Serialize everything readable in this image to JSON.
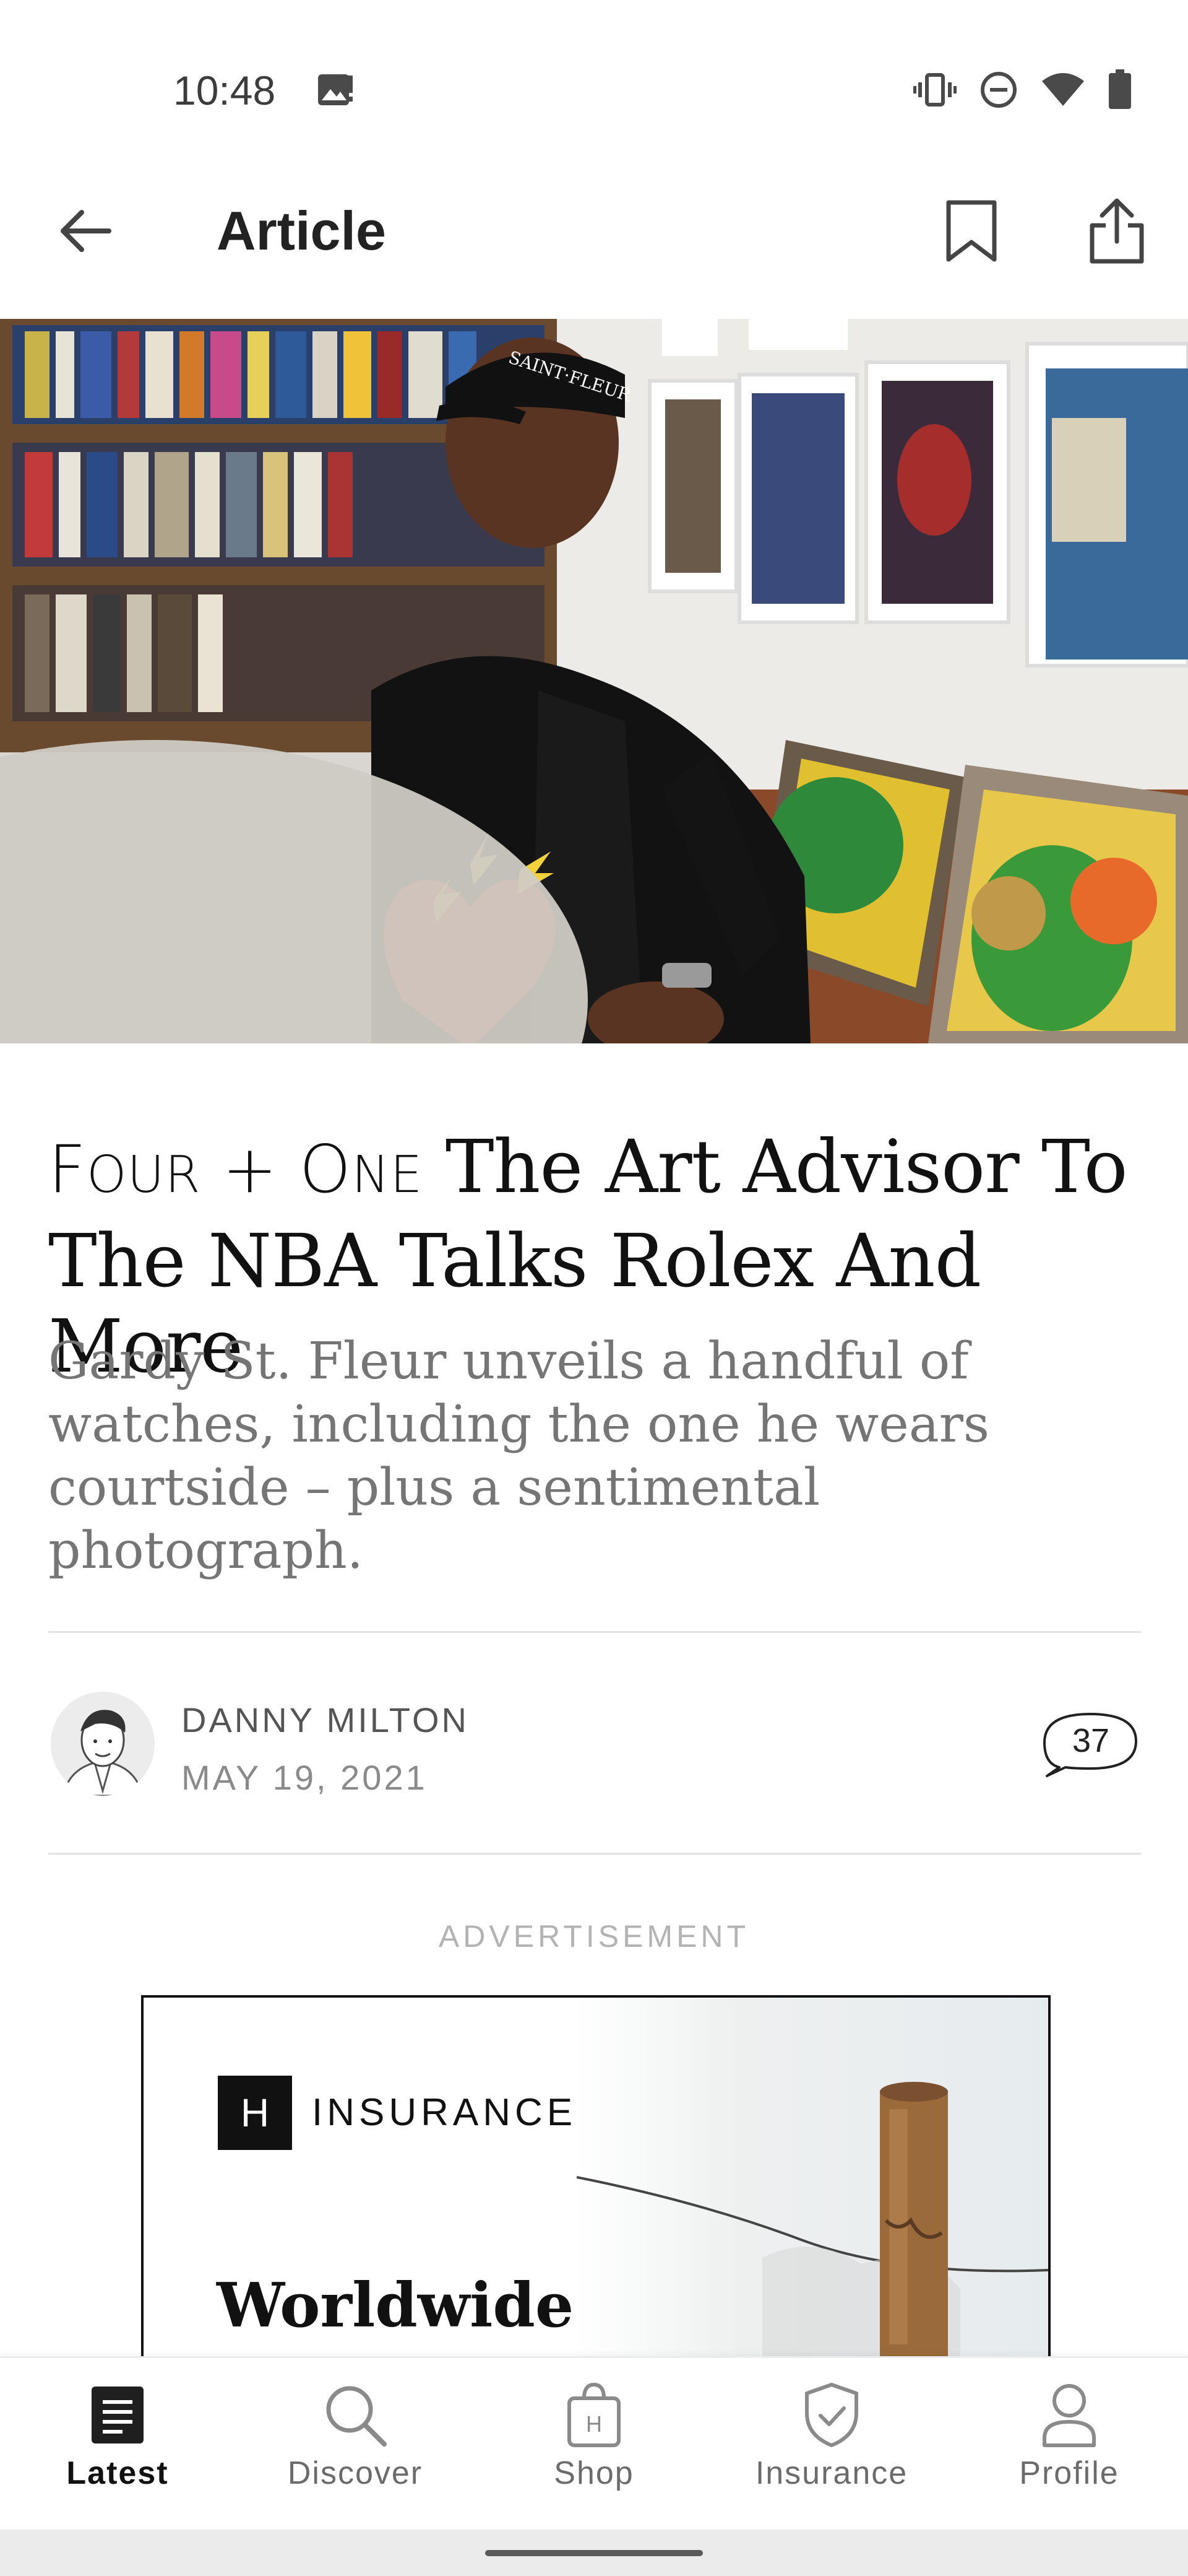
{
  "status_bar": {
    "time": "10:48",
    "icons": [
      "image-notification-icon",
      "vibrate-icon",
      "do-not-disturb-icon",
      "wifi-icon",
      "battery-icon"
    ]
  },
  "app_bar": {
    "title": "Article",
    "icons": [
      "back-arrow-icon",
      "bookmark-icon",
      "share-icon"
    ]
  },
  "article": {
    "kicker_f": "F",
    "kicker_our": "OUR",
    "kicker_plus": " + ",
    "kicker_o": "O",
    "kicker_ne": "NE",
    "headline": " The Art Advisor To The NBA Talks Rolex And More",
    "deck": "Gardy St. Fleur unveils a handful of watches, including the one he wears courtside – plus a sentimental photograph.",
    "author": "DANNY MILTON",
    "date": "MAY 19, 2021",
    "comment_count": "37"
  },
  "advertisement": {
    "label": "ADVERTISEMENT",
    "logo_letter": "H",
    "brand": "INSURANCE",
    "headline": "Worldwide"
  },
  "bottom_nav": {
    "items": [
      {
        "label": "Latest",
        "icon": "latest-icon",
        "active": true
      },
      {
        "label": "Discover",
        "icon": "search-icon",
        "active": false
      },
      {
        "label": "Shop",
        "icon": "shop-bag-icon",
        "active": false
      },
      {
        "label": "Insurance",
        "icon": "shield-check-icon",
        "active": false
      },
      {
        "label": "Profile",
        "icon": "person-icon",
        "active": false
      }
    ]
  },
  "colors": {
    "text_primary": "#111111",
    "text_secondary": "#757575",
    "divider": "#e2e2e2",
    "nav_inactive": "#6b6b6b"
  }
}
